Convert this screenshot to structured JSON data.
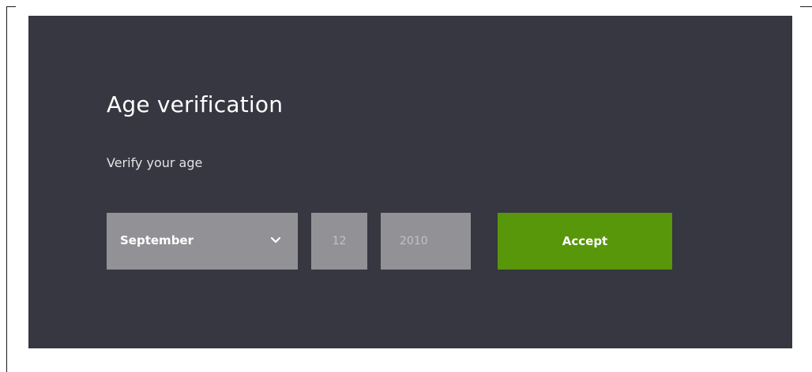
{
  "colors": {
    "panel_bg": "#363741",
    "field_bg": "#929296",
    "accent": "#579709",
    "title_text": "#ffffff"
  },
  "dialog": {
    "title": "Age verification",
    "subtitle": "Verify your age"
  },
  "form": {
    "month": {
      "selected": "September",
      "icon": "chevron-down-icon"
    },
    "day": {
      "value": "12"
    },
    "year": {
      "value": "2010"
    },
    "accept_label": "Accept"
  }
}
